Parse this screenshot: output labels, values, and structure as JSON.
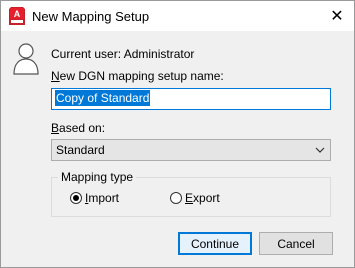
{
  "window": {
    "title": "New Mapping Setup",
    "close_glyph": "✕"
  },
  "content": {
    "current_user_label": "Current user: Administrator",
    "name_label": "New DGN mapping setup name:",
    "name_value": "Copy of Standard",
    "based_on_label": "Based on:",
    "based_on_value": "Standard"
  },
  "mapping_type": {
    "legend": "Mapping type",
    "options": [
      {
        "label": "Import",
        "selected": true
      },
      {
        "label": "Export",
        "selected": false
      }
    ]
  },
  "buttons": {
    "continue": "Continue",
    "cancel": "Cancel"
  },
  "icons": {
    "app": "autocad-app-icon",
    "user": "user-icon",
    "close": "close-icon",
    "dropdown": "chevron-down-icon"
  },
  "colors": {
    "accent": "#0078d7",
    "app_icon": "#e51f2b"
  }
}
